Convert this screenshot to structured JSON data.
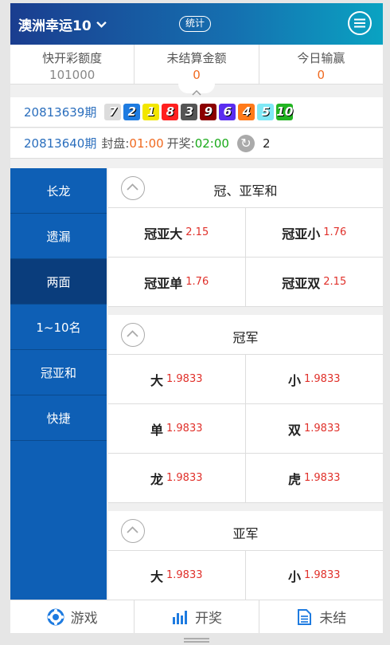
{
  "header": {
    "title": "澳洲幸运10",
    "stat_label": "统计"
  },
  "info": [
    {
      "label": "快开彩额度",
      "value": "101000"
    },
    {
      "label": "未结算金额",
      "value": "0"
    },
    {
      "label": "今日输赢",
      "value": "0"
    }
  ],
  "last_draw": {
    "period": "20813639期",
    "balls": [
      {
        "n": "7",
        "color": "#dcdcdc"
      },
      {
        "n": "2",
        "color": "#1e7be0"
      },
      {
        "n": "1",
        "color": "#f2e600"
      },
      {
        "n": "8",
        "color": "#ff1f1f"
      },
      {
        "n": "3",
        "color": "#555555"
      },
      {
        "n": "9",
        "color": "#8b0000"
      },
      {
        "n": "6",
        "color": "#5a2df0"
      },
      {
        "n": "4",
        "color": "#ff7a1a"
      },
      {
        "n": "5",
        "color": "#7fe8f5"
      },
      {
        "n": "10",
        "color": "#22b422"
      }
    ]
  },
  "next_draw": {
    "period": "20813640期",
    "close_label": "封盘:",
    "close_time": "01:00",
    "draw_label": "开奖:",
    "draw_time": "02:00",
    "count": "2"
  },
  "sidebar": {
    "items": [
      {
        "label": "长龙"
      },
      {
        "label": "遗漏"
      },
      {
        "label": "两面"
      },
      {
        "label": "1~10名"
      },
      {
        "label": "冠亚和"
      },
      {
        "label": "快捷"
      }
    ],
    "active": "两面"
  },
  "sections": [
    {
      "title": "冠、亚军和",
      "items": [
        {
          "label": "冠亚大",
          "odds": "2.15"
        },
        {
          "label": "冠亚小",
          "odds": "1.76"
        },
        {
          "label": "冠亚单",
          "odds": "1.76"
        },
        {
          "label": "冠亚双",
          "odds": "2.15"
        }
      ]
    },
    {
      "title": "冠军",
      "items": [
        {
          "label": "大",
          "odds": "1.9833"
        },
        {
          "label": "小",
          "odds": "1.9833"
        },
        {
          "label": "单",
          "odds": "1.9833"
        },
        {
          "label": "双",
          "odds": "1.9833"
        },
        {
          "label": "龙",
          "odds": "1.9833"
        },
        {
          "label": "虎",
          "odds": "1.9833"
        }
      ]
    },
    {
      "title": "亚军",
      "items": [
        {
          "label": "大",
          "odds": "1.9833"
        },
        {
          "label": "小",
          "odds": "1.9833"
        }
      ]
    }
  ],
  "footer": [
    {
      "label": "游戏",
      "icon": "game-icon"
    },
    {
      "label": "开奖",
      "icon": "chart-icon"
    },
    {
      "label": "未结",
      "icon": "document-icon"
    }
  ]
}
